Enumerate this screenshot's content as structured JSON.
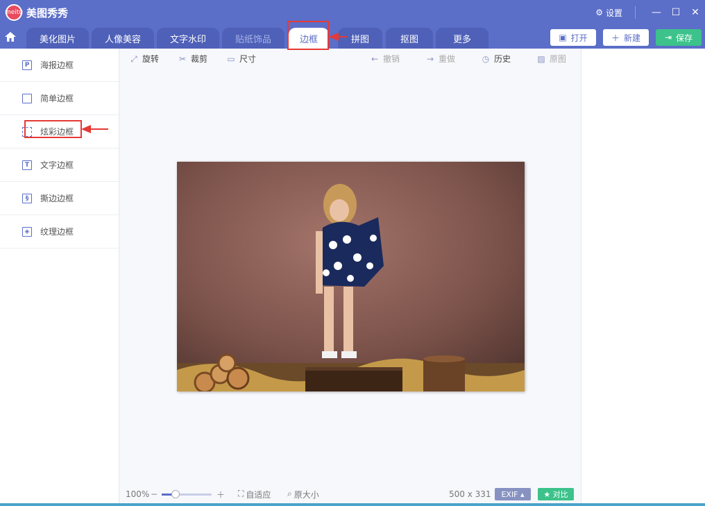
{
  "app": {
    "title": "美图秀秀",
    "logo_text": "meitu"
  },
  "titlebar": {
    "settings_label": "设置"
  },
  "tabs": [
    {
      "label": "美化图片"
    },
    {
      "label": "人像美容"
    },
    {
      "label": "文字水印"
    },
    {
      "label": "贴纸饰品"
    },
    {
      "label": "边框"
    },
    {
      "label": "拼图"
    },
    {
      "label": "抠图"
    },
    {
      "label": "更多"
    }
  ],
  "header_buttons": {
    "open": "打开",
    "new": "新建",
    "save": "保存"
  },
  "sidebar": {
    "items": [
      {
        "label": "海报边框",
        "icon": "P"
      },
      {
        "label": "简单边框",
        "icon": ""
      },
      {
        "label": "炫彩边框",
        "icon": ""
      },
      {
        "label": "文字边框",
        "icon": "T"
      },
      {
        "label": "撕边边框",
        "icon": "§"
      },
      {
        "label": "纹理边框",
        "icon": "◈"
      }
    ]
  },
  "toolbar": {
    "rotate": "旋转",
    "crop": "裁剪",
    "size": "尺寸",
    "undo": "撤销",
    "redo": "重做",
    "history": "历史",
    "original": "原图"
  },
  "status": {
    "zoom": "100%",
    "fit": "自适应",
    "actual_size": "原大小",
    "dimensions": "500 x 331",
    "exif": "EXIF",
    "compare": "对比"
  },
  "colors": {
    "brand": "#5b6ec8",
    "save": "#3cc28a",
    "annotation": "#e53935"
  }
}
